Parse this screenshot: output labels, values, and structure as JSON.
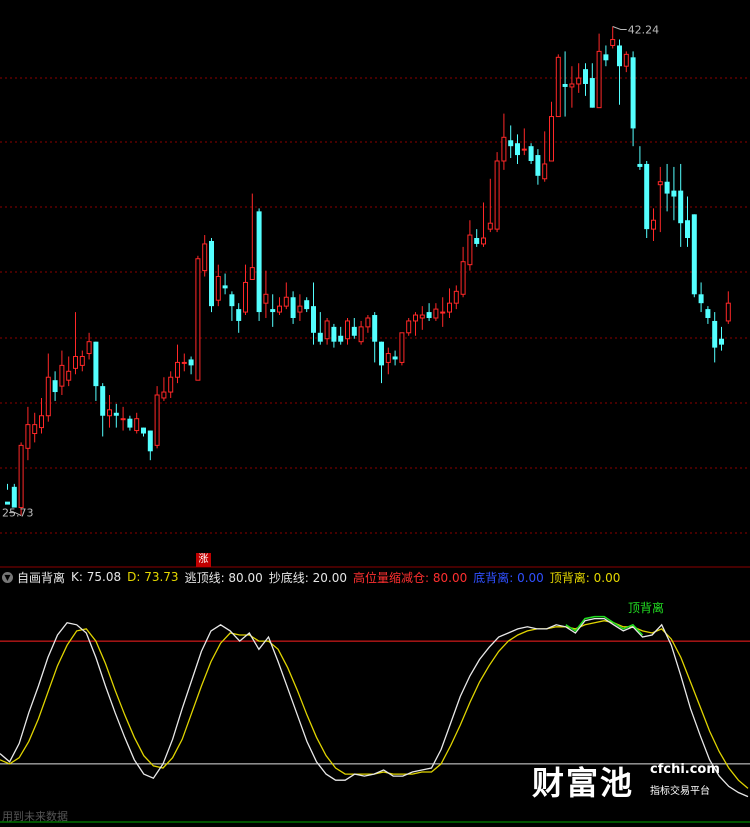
{
  "chart_data": [
    {
      "type": "candlestick",
      "annotations": {
        "high_label": "42.24",
        "low_label": "25.73",
        "rise_badge": "涨"
      },
      "ylim": [
        24.5,
        43
      ],
      "grid": true,
      "candles": [
        [
          26.2,
          26.1,
          26.8,
          26.6
        ],
        [
          26.7,
          26.0,
          26.8,
          26.6
        ],
        [
          26.0,
          28.1,
          28.2,
          25.73
        ],
        [
          28.0,
          28.8,
          29.4,
          27.6
        ],
        [
          28.5,
          28.8,
          29.2,
          28.2
        ],
        [
          28.7,
          29.1,
          29.7,
          28.5
        ],
        [
          29.1,
          30.4,
          31.2,
          28.9
        ],
        [
          30.3,
          29.9,
          30.6,
          29.6
        ],
        [
          30.1,
          30.8,
          31.3,
          29.8
        ],
        [
          30.3,
          30.6,
          31.1,
          30.1
        ],
        [
          30.7,
          31.1,
          32.6,
          30.5
        ],
        [
          30.8,
          31.1,
          31.3,
          30.6
        ],
        [
          31.2,
          31.6,
          31.9,
          31.0
        ],
        [
          31.6,
          30.1,
          31.6,
          29.6
        ],
        [
          30.1,
          29.1,
          30.2,
          28.4
        ],
        [
          29.1,
          29.3,
          29.8,
          28.7
        ],
        [
          29.2,
          29.1,
          29.5,
          28.7
        ],
        [
          29.0,
          29.0,
          29.4,
          28.6
        ],
        [
          29.0,
          28.7,
          29.1,
          28.6
        ],
        [
          28.6,
          29.0,
          29.2,
          28.5
        ],
        [
          28.7,
          28.5,
          28.7,
          28.4
        ],
        [
          28.6,
          27.9,
          28.6,
          27.6
        ],
        [
          28.1,
          29.8,
          30.1,
          28.0
        ],
        [
          29.7,
          29.9,
          30.4,
          29.6
        ],
        [
          29.9,
          30.4,
          30.6,
          29.7
        ],
        [
          30.4,
          30.9,
          31.5,
          30.2
        ],
        [
          30.9,
          30.9,
          31.2,
          30.6
        ],
        [
          31.0,
          30.8,
          31.1,
          30.5
        ],
        [
          30.3,
          34.4,
          34.5,
          30.3
        ],
        [
          34.0,
          34.9,
          35.2,
          33.8
        ],
        [
          35.0,
          32.8,
          35.1,
          32.6
        ],
        [
          33.0,
          33.8,
          34.2,
          32.8
        ],
        [
          33.5,
          33.4,
          33.9,
          33.2
        ],
        [
          33.2,
          32.8,
          33.3,
          32.3
        ],
        [
          32.7,
          32.3,
          32.9,
          31.9
        ],
        [
          32.6,
          33.6,
          34.2,
          32.5
        ],
        [
          33.7,
          34.1,
          36.6,
          33.7
        ],
        [
          36.0,
          32.6,
          36.1,
          32.3
        ],
        [
          32.9,
          33.2,
          34.0,
          32.4
        ],
        [
          32.7,
          32.6,
          33.2,
          32.1
        ],
        [
          32.6,
          32.8,
          33.1,
          32.5
        ],
        [
          32.8,
          33.1,
          33.6,
          32.7
        ],
        [
          33.1,
          32.4,
          33.3,
          32.2
        ],
        [
          32.6,
          32.8,
          33.2,
          32.3
        ],
        [
          33.0,
          32.7,
          33.1,
          32.6
        ],
        [
          32.8,
          31.9,
          33.6,
          31.5
        ],
        [
          31.9,
          31.6,
          32.6,
          31.5
        ],
        [
          31.7,
          32.3,
          32.4,
          31.5
        ],
        [
          32.1,
          31.6,
          32.2,
          31.4
        ],
        [
          31.8,
          31.6,
          32.1,
          31.5
        ],
        [
          31.7,
          32.3,
          32.4,
          31.5
        ],
        [
          32.1,
          31.8,
          32.4,
          31.7
        ],
        [
          31.6,
          32.1,
          32.3,
          31.5
        ],
        [
          32.1,
          32.4,
          32.5,
          31.9
        ],
        [
          32.5,
          31.6,
          32.6,
          30.9
        ],
        [
          31.6,
          30.8,
          31.6,
          30.2
        ],
        [
          30.9,
          31.2,
          31.4,
          30.5
        ],
        [
          31.1,
          31.0,
          31.3,
          30.8
        ],
        [
          30.9,
          31.9,
          31.9,
          30.8
        ],
        [
          31.9,
          32.3,
          32.4,
          31.8
        ],
        [
          32.3,
          32.5,
          32.6,
          31.8
        ],
        [
          32.4,
          32.5,
          32.8,
          32.0
        ],
        [
          32.6,
          32.4,
          32.9,
          32.3
        ],
        [
          32.4,
          32.7,
          32.9,
          32.3
        ],
        [
          32.6,
          32.6,
          33.1,
          32.1
        ],
        [
          32.6,
          32.9,
          33.4,
          32.4
        ],
        [
          32.9,
          33.3,
          33.5,
          32.7
        ],
        [
          33.2,
          34.3,
          34.8,
          33.1
        ],
        [
          34.2,
          35.2,
          35.7,
          34.0
        ],
        [
          35.1,
          34.9,
          35.4,
          34.8
        ],
        [
          34.9,
          35.1,
          36.3,
          34.8
        ],
        [
          35.4,
          35.6,
          37.1,
          35.3
        ],
        [
          35.4,
          37.7,
          38.0,
          35.3
        ],
        [
          37.7,
          38.5,
          39.3,
          37.4
        ],
        [
          38.4,
          38.2,
          38.9,
          37.8
        ],
        [
          38.3,
          37.9,
          38.6,
          37.6
        ],
        [
          38.1,
          38.1,
          38.8,
          37.9
        ],
        [
          38.2,
          37.7,
          38.3,
          37.6
        ],
        [
          37.9,
          37.2,
          38.1,
          36.9
        ],
        [
          37.1,
          37.6,
          38.7,
          37.0
        ],
        [
          37.7,
          39.2,
          39.7,
          37.7
        ],
        [
          39.2,
          41.2,
          41.3,
          39.2
        ],
        [
          40.3,
          40.2,
          41.4,
          39.2
        ],
        [
          40.2,
          40.3,
          40.9,
          39.5
        ],
        [
          40.3,
          40.5,
          41.0,
          40.0
        ],
        [
          40.8,
          40.3,
          41.0,
          39.9
        ],
        [
          40.5,
          39.5,
          41.0,
          39.5
        ],
        [
          39.5,
          41.4,
          42.0,
          39.5
        ],
        [
          41.3,
          41.1,
          41.6,
          40.9
        ],
        [
          41.6,
          41.8,
          42.24,
          41.5
        ],
        [
          41.6,
          40.9,
          41.8,
          39.6
        ],
        [
          40.9,
          41.3,
          41.4,
          40.7
        ],
        [
          41.2,
          38.8,
          41.4,
          38.2
        ],
        [
          37.6,
          37.5,
          38.2,
          37.4
        ],
        [
          37.6,
          35.4,
          37.7,
          35.1
        ],
        [
          35.4,
          35.7,
          36.1,
          35.0
        ],
        [
          36.9,
          37.0,
          37.5,
          35.3
        ],
        [
          37.0,
          36.6,
          37.6,
          36.0
        ],
        [
          36.7,
          36.5,
          37.5,
          35.7
        ],
        [
          36.7,
          35.6,
          37.6,
          34.8
        ],
        [
          35.7,
          35.1,
          36.5,
          34.8
        ],
        [
          35.9,
          33.2,
          35.9,
          33.1
        ],
        [
          33.2,
          32.9,
          33.6,
          32.6
        ],
        [
          32.7,
          32.4,
          32.8,
          32.2
        ],
        [
          32.3,
          31.4,
          32.6,
          30.9
        ],
        [
          31.7,
          31.5,
          32.1,
          31.3
        ],
        [
          32.3,
          32.9,
          33.3,
          32.2
        ]
      ],
      "colors": {
        "up": "#ff2828",
        "down": "#54ffff",
        "grid": "#8b0000"
      }
    },
    {
      "type": "line",
      "title": "自画背离",
      "ylim": [
        -5,
        105
      ],
      "reference_lines": {
        "escape_top": 80,
        "bottom_fish": 20
      },
      "series": [
        {
          "name": "K",
          "color": "#e8e8e8",
          "values": [
            25,
            21,
            30,
            45,
            58,
            72,
            83,
            89,
            88,
            84,
            72,
            58,
            45,
            33,
            22,
            15,
            13,
            20,
            32,
            47,
            61,
            75,
            85,
            88,
            85,
            80,
            84,
            76,
            82,
            70,
            57,
            44,
            31,
            21,
            15,
            12,
            12,
            15,
            14,
            15,
            17,
            14,
            14,
            16,
            17,
            18,
            27,
            40,
            53,
            63,
            71,
            77,
            82,
            84,
            86,
            87,
            86,
            86,
            88,
            87,
            84,
            90,
            91,
            91,
            88,
            85,
            87,
            82,
            83,
            88,
            78,
            63,
            47,
            34,
            22,
            14,
            9,
            6,
            4
          ]
        },
        {
          "name": "D",
          "color": "#e0d400",
          "values": [
            22,
            20,
            23,
            31,
            42,
            55,
            68,
            78,
            85,
            86,
            80,
            69,
            56,
            44,
            33,
            24,
            19,
            18,
            23,
            32,
            45,
            58,
            70,
            79,
            84,
            83,
            83,
            80,
            80,
            76,
            67,
            56,
            44,
            33,
            24,
            18,
            15,
            15,
            15,
            15,
            16,
            15,
            15,
            15,
            16,
            16,
            20,
            29,
            39,
            50,
            60,
            68,
            75,
            80,
            83,
            85,
            86,
            86,
            87,
            87,
            86,
            88,
            89,
            90,
            89,
            87,
            87,
            85,
            84,
            86,
            81,
            72,
            60,
            48,
            36,
            26,
            18,
            12,
            8
          ]
        }
      ]
    }
  ],
  "indicator_header": {
    "name": "自画背离",
    "k_label": "K: 75.08",
    "d_label": "D: 73.73",
    "escape_label": "逃顶线: 80.00",
    "bottom_label": "抄底线: 20.00",
    "reduce_label": "高位量缩减仓: 80.00",
    "bottom_div_label": "底背离: 0.00",
    "top_div_label": "顶背离: 0.00"
  },
  "divergence_marker": "顶背离",
  "watermark": {
    "cn": "财富池",
    "url": "cfchi.com",
    "sub": "指标交易平台"
  },
  "footer_note": "用到未来数据"
}
